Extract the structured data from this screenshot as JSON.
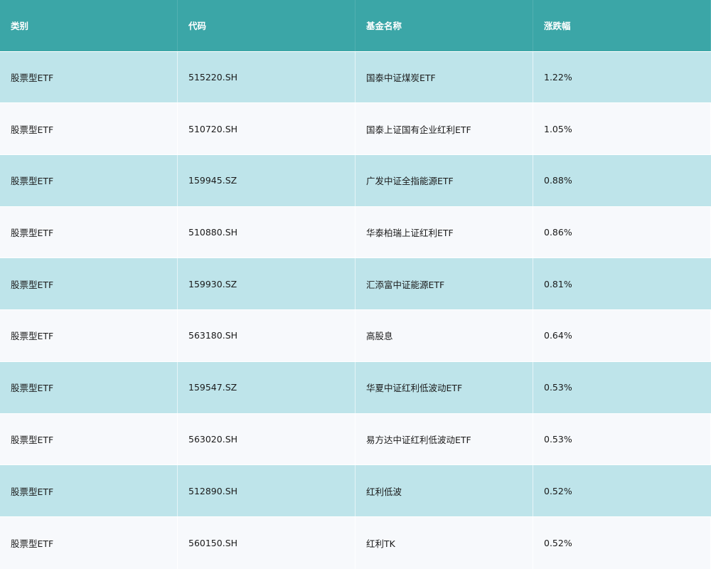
{
  "table": {
    "headers": [
      "类别",
      "代码",
      "基金名称",
      "涨跌幅"
    ],
    "rows": [
      {
        "category": "股票型ETF",
        "code": "515220.SH",
        "name": "国泰中证煤炭ETF",
        "change": "1.22%"
      },
      {
        "category": "股票型ETF",
        "code": "510720.SH",
        "name": "国泰上证国有企业红利ETF",
        "change": "1.05%"
      },
      {
        "category": "股票型ETF",
        "code": "159945.SZ",
        "name": "广发中证全指能源ETF",
        "change": "0.88%"
      },
      {
        "category": "股票型ETF",
        "code": "510880.SH",
        "name": "华泰柏瑞上证红利ETF",
        "change": "0.86%"
      },
      {
        "category": "股票型ETF",
        "code": "159930.SZ",
        "name": "汇添富中证能源ETF",
        "change": "0.81%"
      },
      {
        "category": "股票型ETF",
        "code": "563180.SH",
        "name": "高股息",
        "change": "0.64%"
      },
      {
        "category": "股票型ETF",
        "code": "159547.SZ",
        "name": "华夏中证红利低波动ETF",
        "change": "0.53%"
      },
      {
        "category": "股票型ETF",
        "code": "563020.SH",
        "name": "易方达中证红利低波动ETF",
        "change": "0.53%"
      },
      {
        "category": "股票型ETF",
        "code": "512890.SH",
        "name": "红利低波",
        "change": "0.52%"
      },
      {
        "category": "股票型ETF",
        "code": "560150.SH",
        "name": "红利TK",
        "change": "0.52%"
      }
    ]
  },
  "colors": {
    "header": "#3ba6a7",
    "row_odd": "#bee4ea",
    "row_even": "#f7f9fc"
  }
}
